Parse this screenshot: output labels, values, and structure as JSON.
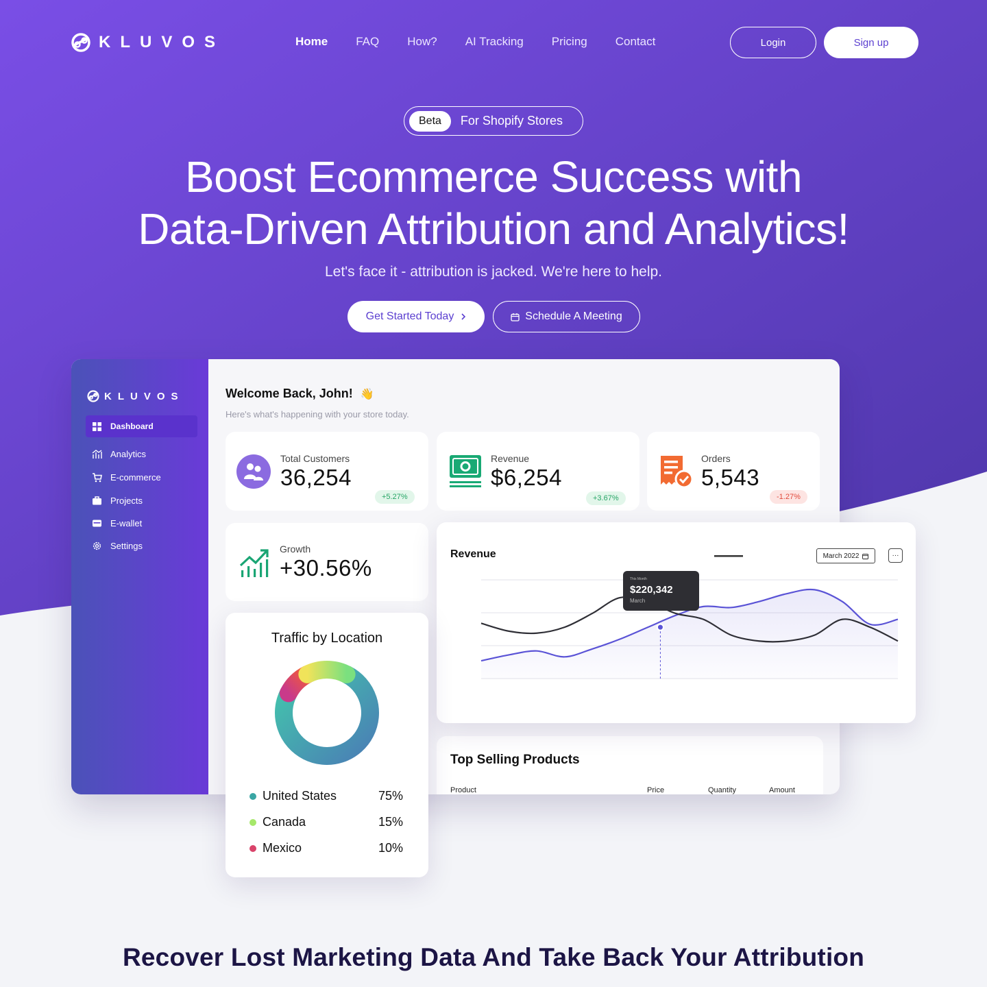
{
  "brand": {
    "name": "KLUVOS"
  },
  "nav": {
    "items": [
      "Home",
      "FAQ",
      "How?",
      "AI Tracking",
      "Pricing",
      "Contact"
    ],
    "login": "Login",
    "signup": "Sign up"
  },
  "hero": {
    "pill_badge": "Beta",
    "pill_text": "For Shopify Stores",
    "headline_line1": "Boost Ecommerce Success with",
    "headline_line2": "Data-Driven Attribution and Analytics!",
    "subheadline": "Let's face it - attribution is jacked. We're here to help.",
    "cta_primary": "Get Started Today",
    "cta_secondary": "Schedule A Meeting"
  },
  "colors": {
    "hero_gradient_start": "#7a4ee6",
    "hero_gradient_end": "#4d36a8",
    "accent": "#5b3fd0",
    "positive": "#27a566",
    "negative": "#e14a3c"
  },
  "dashboard": {
    "sidebar": {
      "items": [
        {
          "label": "Dashboard",
          "icon": "grid-icon",
          "active": true
        },
        {
          "label": "Analytics",
          "icon": "analytics-icon"
        },
        {
          "label": "E-commerce",
          "icon": "cart-icon"
        },
        {
          "label": "Projects",
          "icon": "briefcase-icon"
        },
        {
          "label": "E-wallet",
          "icon": "wallet-icon"
        },
        {
          "label": "Settings",
          "icon": "gear-icon"
        }
      ]
    },
    "welcome": "Welcome Back, John!",
    "welcome_emoji": "👋",
    "welcome_sub": "Here's what's happening with your store today.",
    "stats": [
      {
        "label": "Total Customers",
        "value": "36,254",
        "change": "+5.27%",
        "trend": "up"
      },
      {
        "label": "Revenue",
        "value": "$6,254",
        "change": "+3.67%",
        "trend": "up"
      },
      {
        "label": "Orders",
        "value": "5,543",
        "change": "-1.27%",
        "trend": "down"
      }
    ],
    "growth": {
      "label": "Growth",
      "value": "+30.56%"
    },
    "traffic": {
      "title": "Traffic by Location",
      "rows": [
        {
          "name": "United States",
          "pct": "75%",
          "color": "#3aa6a4"
        },
        {
          "name": "Canada",
          "pct": "15%",
          "color": "#a6e86a"
        },
        {
          "name": "Mexico",
          "pct": "10%",
          "color": "#d9436a"
        }
      ]
    },
    "revenue_chart": {
      "title": "Revenue",
      "date": "March 2022",
      "more": "···",
      "tooltip": {
        "caption": "This Month",
        "value": "$220,342",
        "month": "March"
      }
    },
    "top_selling": {
      "title": "Top Selling Products",
      "columns": [
        "Product",
        "Price",
        "Quantity",
        "Amount"
      ]
    }
  },
  "bottom_heading": "Recover Lost Marketing Data And Take Back Your Attribution",
  "chart_data": [
    {
      "type": "pie",
      "title": "Traffic by Location",
      "categories": [
        "United States",
        "Canada",
        "Mexico"
      ],
      "values": [
        75,
        15,
        10
      ]
    },
    {
      "type": "line",
      "title": "Revenue",
      "series": [
        {
          "values": [
            18,
            24,
            28,
            22,
            30,
            40,
            52,
            64,
            73,
            72,
            78,
            86,
            90,
            78,
            55,
            60
          ]
        },
        {
          "values": [
            56,
            48,
            46,
            52,
            66,
            82,
            78,
            66,
            60,
            44,
            38,
            38,
            44,
            60,
            52,
            38
          ]
        }
      ]
    }
  ]
}
